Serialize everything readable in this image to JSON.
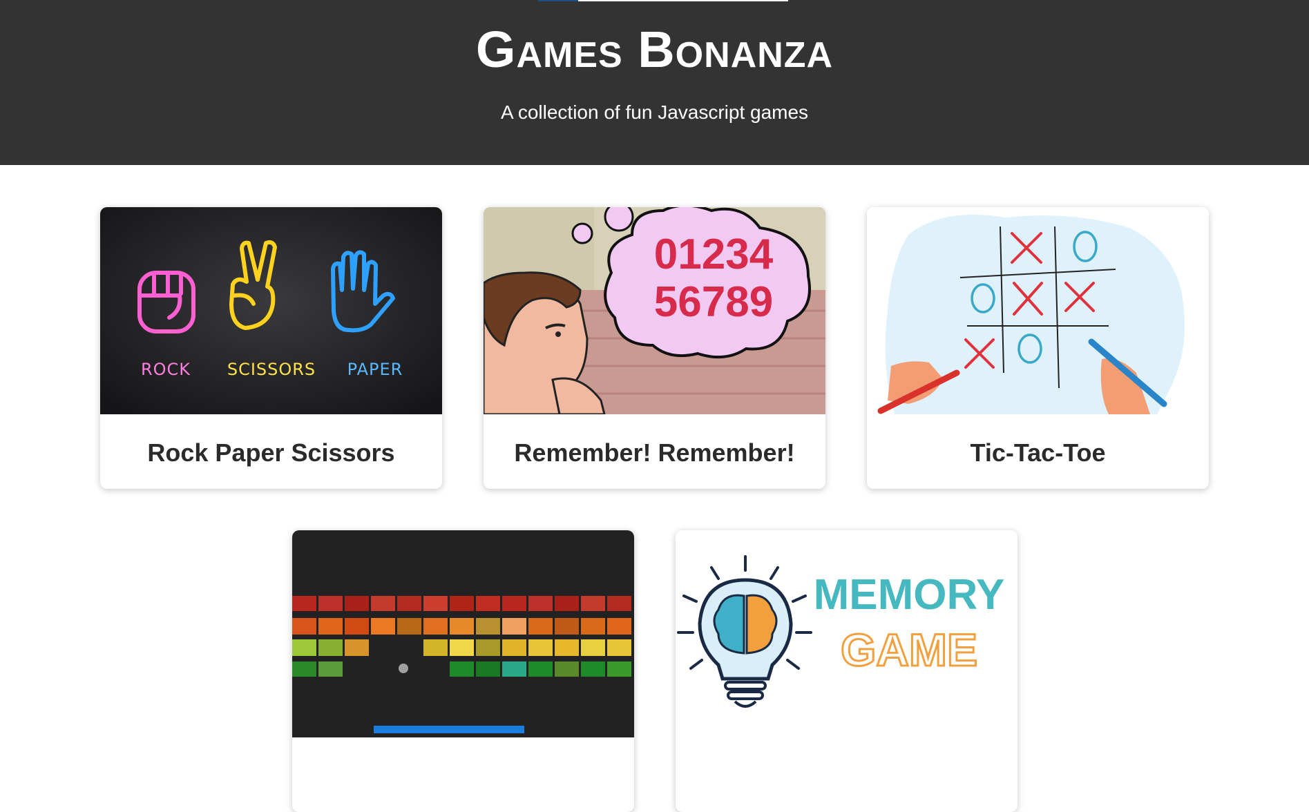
{
  "header": {
    "title": "Games Bonanza",
    "subtitle": "A collection of fun Javascript games",
    "progress": 0.16
  },
  "games": [
    {
      "label": "Rock Paper Scissors",
      "image_text": [
        "ROCK",
        "SCISSORS",
        "PAPER"
      ]
    },
    {
      "label": "Remember! Remember!",
      "image_text": [
        "01234",
        "56789"
      ]
    },
    {
      "label": "Tic-Tac-Toe"
    },
    {
      "label": ""
    },
    {
      "label": "",
      "image_text": [
        "MEMORY",
        "GAME"
      ]
    }
  ],
  "colors": {
    "header_bg": "#333333",
    "progress": "#1e4f8f",
    "memory_teal": "#45b8c0",
    "memory_orange": "#f2a03d",
    "paddle": "#1a7de0"
  }
}
